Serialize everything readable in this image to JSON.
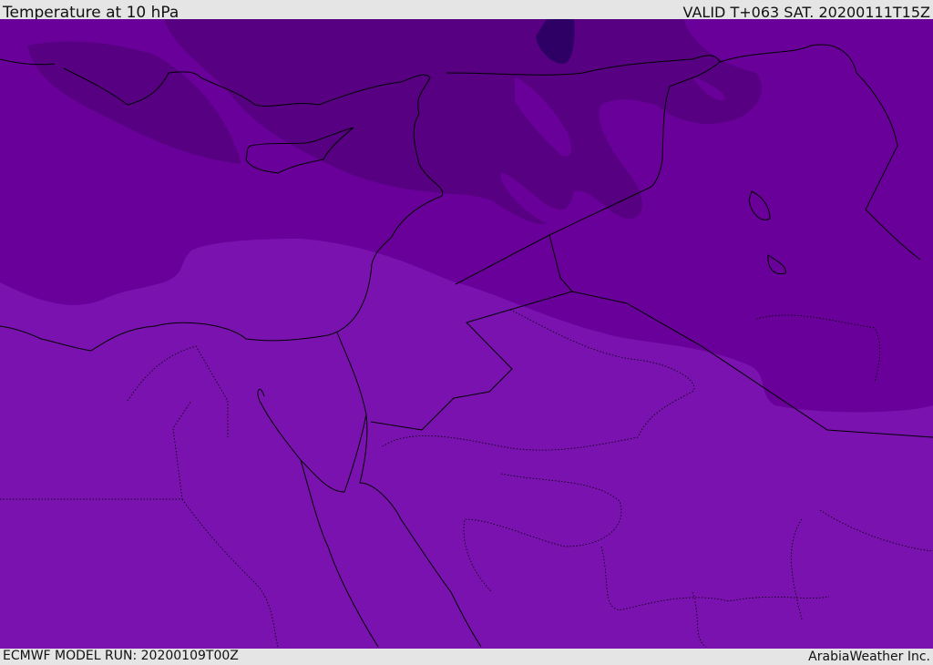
{
  "header": {
    "title": "Temperature at 10 hPa",
    "valid": "VALID T+063 SAT. 20200111T15Z"
  },
  "footer": {
    "model_run": "ECMWF MODEL RUN: 20200109T00Z",
    "credit": "ArabiaWeather Inc."
  },
  "colors": {
    "level_warm": "#7a12b0",
    "level_mid": "#69009a",
    "level_cool": "#570082",
    "level_cold": "#2e0066",
    "coastline": "#000000"
  }
}
